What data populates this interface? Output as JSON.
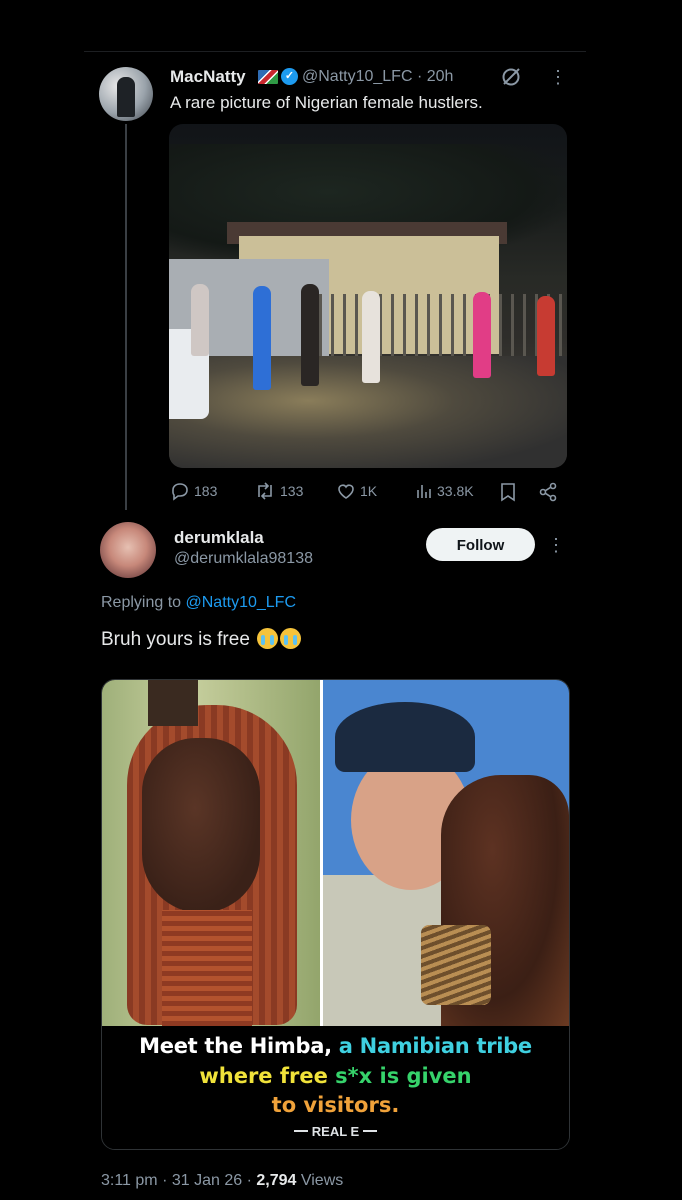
{
  "tweet": {
    "author_name": "MacNatty",
    "handle_time": "@Natty10_LFC · 20h",
    "text": "A rare picture of Nigerian female hustlers.",
    "stats": {
      "replies": "183",
      "retweets": "133",
      "likes": "1K",
      "views": "33.8K"
    }
  },
  "reply": {
    "author_name": "derumklala",
    "handle": "@derumklala98138",
    "follow_label": "Follow",
    "replying_prefix": "Replying to",
    "replying_handle": "@Natty10_LFC",
    "text": "Bruh yours is free",
    "emoji": "loudly-crying-face",
    "media_caption": {
      "line1_a": "Meet the Himba,",
      "line1_b": "a Namibian tribe",
      "line2_a": "where free",
      "line2_b": "s*x is given",
      "line3": "to visitors.",
      "watermark": "REAL E"
    },
    "time_date": "3:11 pm · 31 Jan 26 ·",
    "views_count": "2,794",
    "views_label": "Views"
  },
  "colors": {
    "background": "#000000",
    "text_primary": "#e7e9ea",
    "text_secondary": "#8b98a5",
    "accent_blue": "#1d9bf0"
  },
  "icons": [
    "verified-badge-icon",
    "grok-icon",
    "more-options-icon",
    "reply-icon",
    "retweet-icon",
    "like-icon",
    "views-icon",
    "bookmark-icon",
    "share-icon",
    "loudly-crying-emoji"
  ]
}
